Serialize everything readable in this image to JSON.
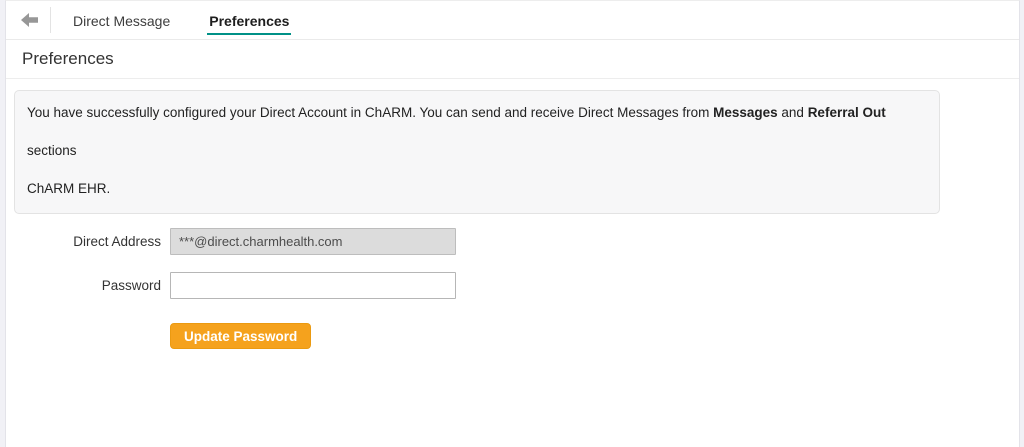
{
  "topbar": {
    "tabs": [
      {
        "label": "Direct Message",
        "active": false
      },
      {
        "label": "Preferences",
        "active": true
      }
    ]
  },
  "page": {
    "title": "Preferences"
  },
  "info_message": {
    "text_before": "You have successfully configured your Direct Account in ChARM. You can send and receive Direct Messages from ",
    "bold_messages": "Messages",
    "text_middle": " and ",
    "bold_referral": "Referral Out",
    "text_after": " sections",
    "line2": "ChARM EHR."
  },
  "form": {
    "direct_address": {
      "label": "Direct Address",
      "value": "***@direct.charmhealth.com"
    },
    "password": {
      "label": "Password",
      "value": ""
    },
    "update_button_label": "Update Password"
  },
  "colors": {
    "active_tab_underline": "#009187",
    "button_orange": "#f5a21d",
    "disabled_field_bg": "#dcdcdc",
    "info_box_bg": "#f7f7f8"
  }
}
